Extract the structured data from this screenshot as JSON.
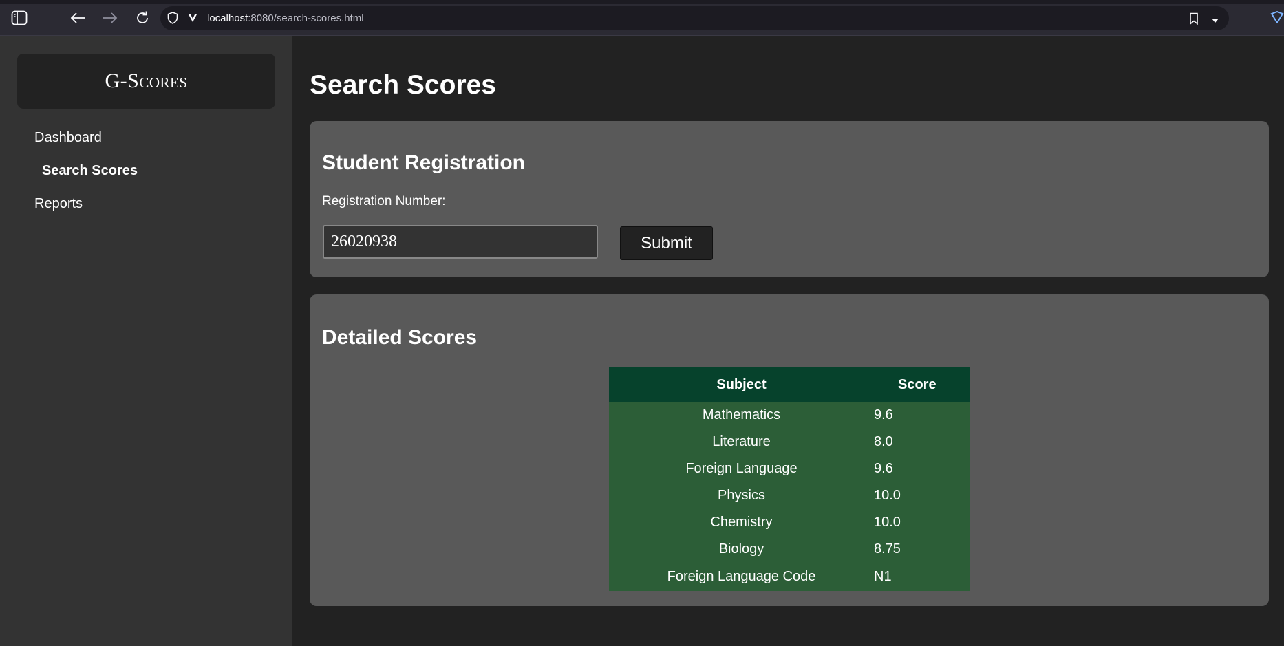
{
  "browser": {
    "url_host": "localhost",
    "url_path": ":8080/search-scores.html"
  },
  "sidebar": {
    "brand": "G-Scores",
    "items": [
      {
        "label": "Dashboard"
      },
      {
        "label": "Search Scores",
        "active": true
      },
      {
        "label": "Reports"
      }
    ]
  },
  "main": {
    "title": "Search Scores",
    "registration": {
      "heading": "Student Registration",
      "label": "Registration Number:",
      "value": "26020938",
      "submit_label": "Submit"
    },
    "details": {
      "heading": "Detailed Scores",
      "columns": [
        "Subject",
        "Score"
      ],
      "rows": [
        {
          "subject": "Mathematics",
          "score": "9.6"
        },
        {
          "subject": "Literature",
          "score": "8.0"
        },
        {
          "subject": "Foreign Language",
          "score": "9.6"
        },
        {
          "subject": "Physics",
          "score": "10.0"
        },
        {
          "subject": "Chemistry",
          "score": "10.0"
        },
        {
          "subject": "Biology",
          "score": "8.75"
        },
        {
          "subject": "Foreign Language Code",
          "score": "N1"
        }
      ]
    }
  },
  "colors": {
    "page_bg": "#222222",
    "sidebar_bg": "#333333",
    "card_bg": "#595959",
    "table_header_bg": "#06422c",
    "table_body_bg": "#2c5e37"
  }
}
